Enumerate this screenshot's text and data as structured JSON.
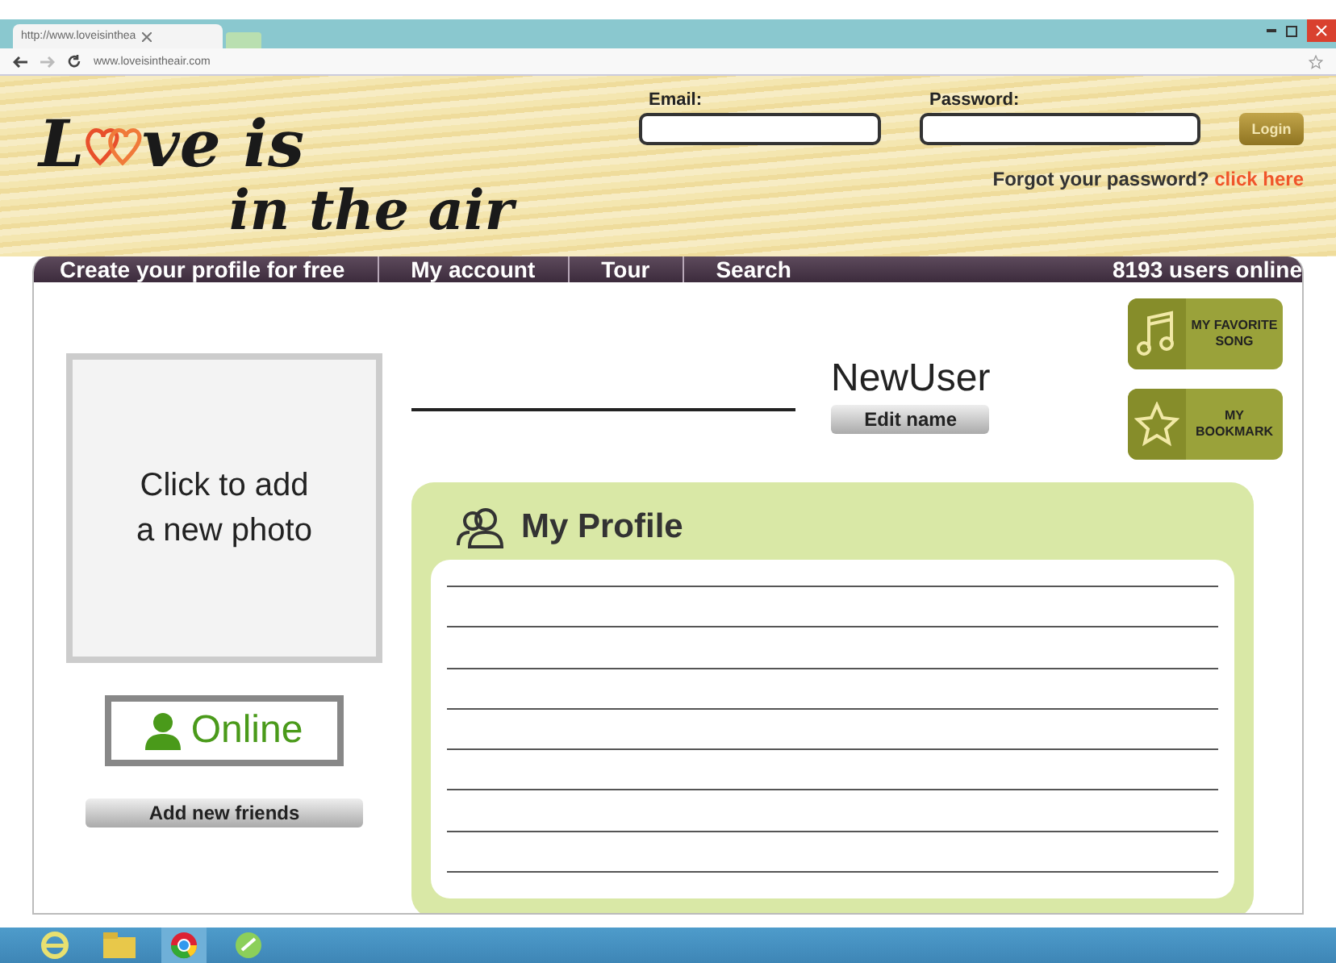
{
  "browser": {
    "tab_title": "http://www.loveisinthea",
    "url": "www.loveisintheair.com"
  },
  "logo": {
    "first": "L",
    "rest": "ve is",
    "second_line": "in the air"
  },
  "login": {
    "email_label": "Email:",
    "password_label": "Password:",
    "button": "Login",
    "forgot": "Forgot your password?",
    "forgot_link": "click here"
  },
  "nav": {
    "items": [
      {
        "label": "Create your profile for free"
      },
      {
        "label": "My account"
      },
      {
        "label": "Tour"
      },
      {
        "label": "Search"
      }
    ],
    "online_count": "8193 users online"
  },
  "photo": {
    "prompt": "Click to add a new photo"
  },
  "status": {
    "label": "Online"
  },
  "add_friends": "Add new friends",
  "user": {
    "name": "NewUser",
    "edit": "Edit name"
  },
  "side_buttons": [
    {
      "kind": "music",
      "label": "MY FAVORITE SONG"
    },
    {
      "kind": "star",
      "label": "MY BOOKMARK"
    }
  ],
  "profile": {
    "title": "My Profile"
  }
}
